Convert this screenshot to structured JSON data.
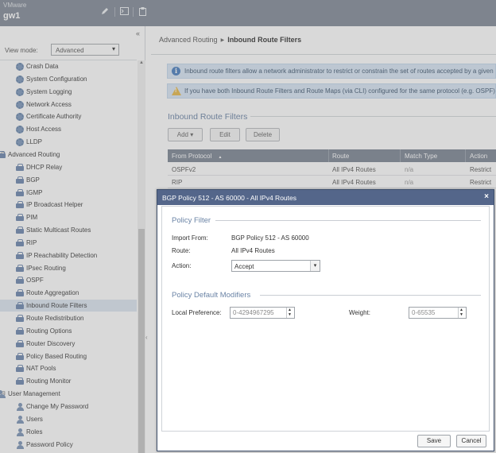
{
  "header": {
    "vendor": "VMware",
    "host": "gw1",
    "tools": [
      "edit-icon",
      "terminal-icon",
      "clipboard-icon"
    ]
  },
  "sidebar": {
    "collapse_glyph": "«",
    "view_mode": {
      "label": "View mode:",
      "value": "Advanced"
    },
    "items": [
      {
        "label": "Crash Data",
        "icon": "gear-icon",
        "level": 2
      },
      {
        "label": "System Configuration",
        "icon": "gear-icon",
        "level": 2
      },
      {
        "label": "System Logging",
        "icon": "gear-icon",
        "level": 2
      },
      {
        "label": "Network Access",
        "icon": "gear-icon",
        "level": 2
      },
      {
        "label": "Certificate Authority",
        "icon": "gear-icon",
        "level": 2
      },
      {
        "label": "Host Access",
        "icon": "gear-icon",
        "level": 2
      },
      {
        "label": "LLDP",
        "icon": "gear-icon",
        "level": 2
      },
      {
        "label": "Advanced Routing",
        "icon": "routing-icon",
        "level": 1,
        "toggle": "⊟"
      },
      {
        "label": "DHCP Relay",
        "icon": "routing-icon",
        "level": 2
      },
      {
        "label": "BGP",
        "icon": "routing-icon",
        "level": 2
      },
      {
        "label": "IGMP",
        "icon": "routing-icon",
        "level": 2
      },
      {
        "label": "IP Broadcast Helper",
        "icon": "routing-icon",
        "level": 2
      },
      {
        "label": "PIM",
        "icon": "routing-icon",
        "level": 2
      },
      {
        "label": "Static Multicast Routes",
        "icon": "routing-icon",
        "level": 2
      },
      {
        "label": "RIP",
        "icon": "routing-icon",
        "level": 2
      },
      {
        "label": "IP Reachability Detection",
        "icon": "routing-icon",
        "level": 2
      },
      {
        "label": "IPsec Routing",
        "icon": "routing-icon",
        "level": 2
      },
      {
        "label": "OSPF",
        "icon": "routing-icon",
        "level": 2
      },
      {
        "label": "Route Aggregation",
        "icon": "routing-icon",
        "level": 2
      },
      {
        "label": "Inbound Route Filters",
        "icon": "routing-icon",
        "level": 2,
        "selected": true
      },
      {
        "label": "Route Redistribution",
        "icon": "routing-icon",
        "level": 2
      },
      {
        "label": "Routing Options",
        "icon": "routing-icon",
        "level": 2
      },
      {
        "label": "Router Discovery",
        "icon": "routing-icon",
        "level": 2
      },
      {
        "label": "Policy Based Routing",
        "icon": "routing-icon",
        "level": 2
      },
      {
        "label": "NAT Pools",
        "icon": "routing-icon",
        "level": 2
      },
      {
        "label": "Routing Monitor",
        "icon": "routing-icon",
        "level": 2
      },
      {
        "label": "User Management",
        "icon": "users-icon",
        "level": 1,
        "toggle": "⊟"
      },
      {
        "label": "Change My Password",
        "icon": "user-icon",
        "level": 2
      },
      {
        "label": "Users",
        "icon": "user-icon",
        "level": 2
      },
      {
        "label": "Roles",
        "icon": "user-icon",
        "level": 2
      },
      {
        "label": "Password Policy",
        "icon": "user-icon",
        "level": 2
      }
    ]
  },
  "main": {
    "breadcrumb": {
      "parent": "Advanced Routing",
      "current": "Inbound Route Filters"
    },
    "info_text": "Inbound route filters allow a network administrator to restrict or constrain the set of routes accepted by a given r",
    "warning_text": "If you have both Inbound Route Filters and Route Maps (via CLI) configured for the same protocol (e.g. OSPF), Ro",
    "section_title": "Inbound Route Filters",
    "buttons": {
      "add": "Add",
      "add_arrow": "▾",
      "edit": "Edit",
      "delete": "Delete"
    },
    "table": {
      "columns": [
        "From Protocol",
        "Route",
        "Match Type",
        "Action"
      ],
      "sort_glyph": "▲",
      "rows": [
        [
          "OSPFv2",
          "All IPv4 Routes",
          "n/a",
          "Restrict"
        ],
        [
          "RIP",
          "All IPv4 Routes",
          "n/a",
          "Restrict"
        ]
      ]
    }
  },
  "dialog": {
    "title": "BGP Policy 512 - AS 60000 - All IPv4 Routes",
    "close_glyph": "×",
    "policy_filter": {
      "title": "Policy Filter",
      "import_from_label": "Import From:",
      "import_from_value": "BGP Policy 512 - AS 60000",
      "route_label": "Route:",
      "route_value": "All IPv4 Routes",
      "action_label": "Action:",
      "action_value": "Accept"
    },
    "modifiers": {
      "title": "Policy Default Modifiers",
      "local_pref_label": "Local Preference:",
      "local_pref_placeholder": "0-4294967295",
      "weight_label": "Weight:",
      "weight_placeholder": "0-65535"
    },
    "save": "Save",
    "cancel": "Cancel"
  }
}
